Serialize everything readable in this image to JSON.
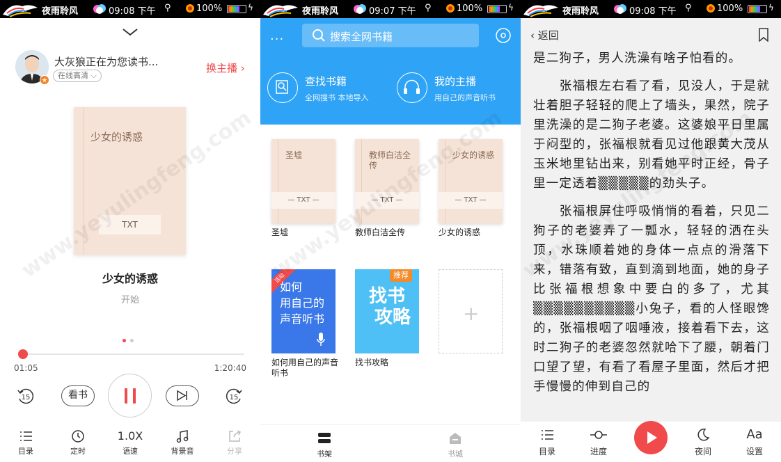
{
  "status_bars": [
    {
      "app": "夜雨聆风",
      "time": "09:08 下午",
      "battery": "100%"
    },
    {
      "app": "夜雨聆风",
      "time": "09:07 下午",
      "battery": "100%"
    },
    {
      "app": "夜雨聆风",
      "time": "09:08 下午",
      "battery": "100%"
    }
  ],
  "player": {
    "anchor_text": "大灰狼正在为您读书...",
    "quality": "在线高清",
    "switch_anchor": "换主播",
    "cover_title": "少女的诱惑",
    "cover_format": "TXT",
    "book_title": "少女的诱惑",
    "status": "开始",
    "time_current": "01:05",
    "time_total": "1:20:40",
    "progress": 0.02,
    "rewind_seconds": "15",
    "forward_seconds": "15",
    "read_label": "看书",
    "bottom": [
      {
        "label": "目录",
        "icon": "list-icon"
      },
      {
        "label": "定时",
        "icon": "clock-icon"
      },
      {
        "label": "语速",
        "value": "1.0X",
        "icon": "speed-icon"
      },
      {
        "label": "背景音",
        "icon": "music-note-icon"
      },
      {
        "label": "分享",
        "icon": "share-icon"
      }
    ]
  },
  "shelf": {
    "menu_icon": "more-dots-icon",
    "search_placeholder": "搜索全网书籍",
    "entries": [
      {
        "title": "查找书籍",
        "subtitle": "全网搜书 本地导入",
        "icon": "find-book-icon"
      },
      {
        "title": "我的主播",
        "subtitle": "用自己的声音听书",
        "icon": "headphones-icon"
      }
    ],
    "books": [
      {
        "cover_title": "圣墟",
        "format": "— TXT —",
        "name": "圣墟"
      },
      {
        "cover_title": "教师白洁全传",
        "format": "— TXT —",
        "name": "教师白洁全传"
      },
      {
        "cover_title": "少女的诱惑",
        "format": "— TXT —",
        "name": "少女的诱惑"
      }
    ],
    "promos": [
      {
        "ribbon": "活动",
        "text_lines": [
          "如何",
          "用自己的",
          "声音听书"
        ],
        "name": "如何用自己的声音听书"
      },
      {
        "tag": "推荐",
        "text_lines": [
          "找书",
          "攻略"
        ],
        "name": "找书攻略"
      }
    ],
    "add_symbol": "+",
    "tabs": [
      {
        "label": "书架",
        "active": true,
        "icon": "bookshelf-icon"
      },
      {
        "label": "书城",
        "active": false,
        "icon": "bookstore-icon"
      }
    ]
  },
  "reader": {
    "back_label": "返回",
    "paragraphs": [
      "是二狗子，男人洗澡有啥子怕看的。",
      "　　张福根左右看了看，见没人，于是就壮着胆子轻轻的爬上了墙头，果然，院子里洗澡的是二狗子老婆。这婆娘平日里属于闷型的，张福根就看见过他跟黄大茂从玉米地里钻出来，别看她平时正经，骨子里一定透着▒▒▒▒▒的劲头子。",
      "　　张福根屏住呼吸悄悄的看着，只见二狗子的老婆弄了一瓢水，轻轻的洒在头顶，水珠顺着她的身体一点点的滑落下来，错落有致，直到滴到地面，她的身子比张福根想象中要白的多了，尤其▒▒▒▒▒▒▒▒▒▒小兔子，看的人怪眼馋的，张福根咽了咽唾液，接着看下去，这时二狗子的老婆忽然就哈下了腰，朝着门口望了望，有看了看屋子里面，然后才把手慢慢的伸到自己的"
    ],
    "bottom": [
      {
        "label": "目录",
        "icon": "list-icon"
      },
      {
        "label": "进度",
        "icon": "progress-icon"
      },
      {
        "label": "夜间",
        "icon": "moon-icon"
      },
      {
        "label": "设置",
        "icon": "font-settings-icon",
        "glyph": "Aa"
      }
    ]
  },
  "watermark": "www.yeyulingfeng.com",
  "colors": {
    "accent_red": "#f04a4a",
    "shelf_blue": "#2fa3f5",
    "cover_peach": "#f6e3d7"
  }
}
